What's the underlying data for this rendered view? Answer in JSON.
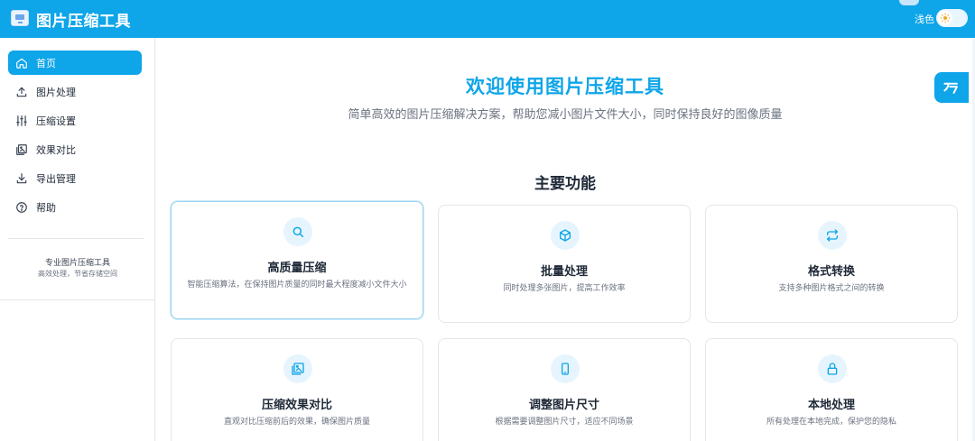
{
  "header": {
    "app_title": "图片压缩工具",
    "theme_label": "浅色"
  },
  "sidebar": {
    "items": [
      {
        "label": "首页",
        "icon": "home-icon"
      },
      {
        "label": "图片处理",
        "icon": "upload-icon"
      },
      {
        "label": "压缩设置",
        "icon": "sliders-icon"
      },
      {
        "label": "效果对比",
        "icon": "gallery-icon"
      },
      {
        "label": "导出管理",
        "icon": "download-icon"
      },
      {
        "label": "帮助",
        "icon": "help-icon"
      }
    ],
    "active_index": 0,
    "footer_title": "专业图片压缩工具",
    "footer_subtitle": "高效处理，节省存储空间"
  },
  "main": {
    "hero_title": "欢迎使用图片压缩工具",
    "hero_subtitle": "简单高效的图片压缩解决方案，帮助您减小图片文件大小，同时保持良好的图像质量",
    "section_title": "主要功能",
    "features": [
      {
        "title": "高质量压缩",
        "desc": "智能压缩算法，在保持图片质量的同时最大程度减小文件大小",
        "icon": "search-icon"
      },
      {
        "title": "批量处理",
        "desc": "同时处理多张图片，提高工作效率",
        "icon": "box-icon"
      },
      {
        "title": "格式转换",
        "desc": "支持多种图片格式之间的转换",
        "icon": "swap-icon"
      },
      {
        "title": "压缩效果对比",
        "desc": "直观对比压缩前后的效果，确保图片质量",
        "icon": "image-compare-icon"
      },
      {
        "title": "调整图片尺寸",
        "desc": "根据需要调整图片尺寸，适应不同场景",
        "icon": "phone-icon"
      },
      {
        "title": "本地处理",
        "desc": "所有处理在本地完成，保护您的隐私",
        "icon": "lock-icon"
      }
    ]
  },
  "colors": {
    "accent": "#0ea5e9",
    "icon_bg": "#e6f5fd"
  }
}
